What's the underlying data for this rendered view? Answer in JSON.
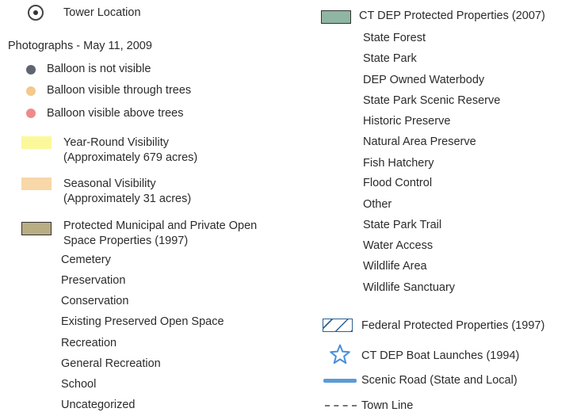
{
  "colors": {
    "balloon_not_visible": "#5e6470",
    "balloon_through_trees": "#f3c98c",
    "balloon_above_trees": "#f08a8a",
    "year_round": "#fbf89c",
    "seasonal": "#f8d7a8",
    "municipal": "#b9ad84",
    "ct_dep": "#8fb5a3",
    "federal": "#2f5f8f",
    "boat_launch": "#4a90d9",
    "scenic_road": "#5b9bd5",
    "town_line": "#777777"
  },
  "left": {
    "tower_location": "Tower Location",
    "photographs_heading": "Photographs - May 11, 2009",
    "balloon_not_visible": "Balloon is not visible",
    "balloon_through_trees": "Balloon visible through trees",
    "balloon_above_trees": "Balloon visible above trees",
    "year_round": [
      "Year-Round Visibility",
      "(Approximately 679 acres)"
    ],
    "seasonal": [
      "Seasonal Visibility",
      "(Approximately 31 acres)"
    ],
    "municipal": [
      "Protected Municipal and Private Open",
      "Space Properties (1997)"
    ],
    "municipal_items": [
      "Cemetery",
      "Preservation",
      "Conservation",
      "Existing Preserved Open Space",
      "Recreation",
      "General Recreation",
      "School",
      "Uncategorized"
    ]
  },
  "right": {
    "ct_dep_heading": "CT DEP Protected Properties (2007)",
    "ct_dep_items": [
      "State Forest",
      "State Park",
      "DEP Owned Waterbody",
      "State Park Scenic Reserve",
      "Historic Preserve",
      "Natural Area Preserve",
      "Fish Hatchery",
      "Flood Control",
      "Other",
      "State Park Trail",
      "Water Access",
      "Wildlife Area",
      "Wildlife Sanctuary"
    ],
    "federal": "Federal Protected Properties (1997)",
    "boat_launch": "CT DEP Boat Launches (1994)",
    "scenic_road": "Scenic Road (State and Local)",
    "town_line": "Town Line"
  }
}
